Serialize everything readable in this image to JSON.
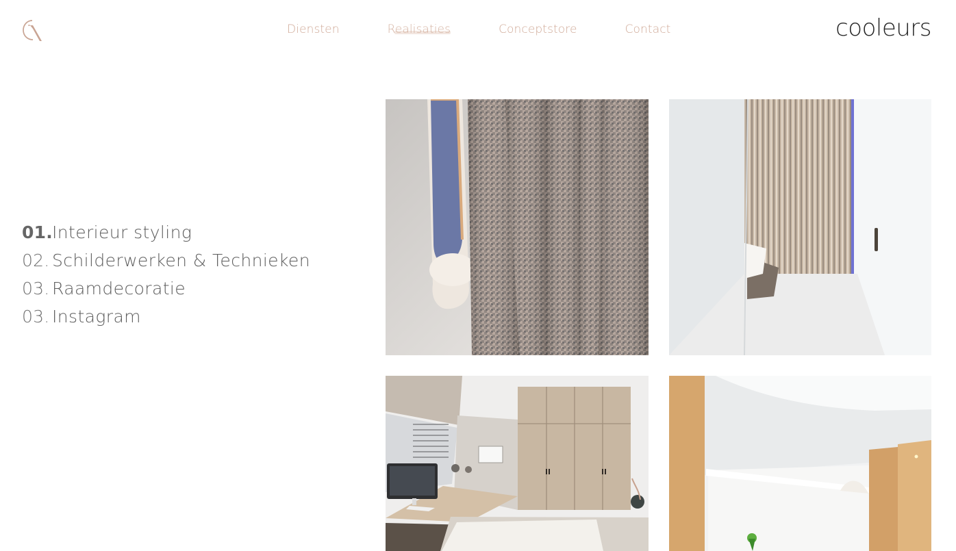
{
  "header": {
    "brand_name": "cooleurs",
    "nav": [
      {
        "label": "Diensten",
        "active": false
      },
      {
        "label": "Realisaties",
        "active": true
      },
      {
        "label": "Conceptstore",
        "active": false
      },
      {
        "label": "Contact",
        "active": false
      }
    ],
    "logo_icon": "brand-monogram-icon"
  },
  "services": [
    {
      "number": "01.",
      "label": "Interieur styling",
      "active": true
    },
    {
      "number": "02.",
      "label": "Schilderwerken & Technieken",
      "active": false
    },
    {
      "number": "03.",
      "label": "Raamdecoratie",
      "active": false
    },
    {
      "number": "03.",
      "label": "Instagram",
      "active": false
    }
  ],
  "gallery": {
    "tiles": [
      {
        "subject": "curtain fabric close-up"
      },
      {
        "subject": "bedroom curtains"
      },
      {
        "subject": "home office cabinets"
      },
      {
        "subject": "white shelving and wood panels"
      }
    ]
  },
  "colors": {
    "accent": "#d0aa98",
    "text": "#5d5d5d",
    "brand": "#262626",
    "background": "#ffffff"
  }
}
